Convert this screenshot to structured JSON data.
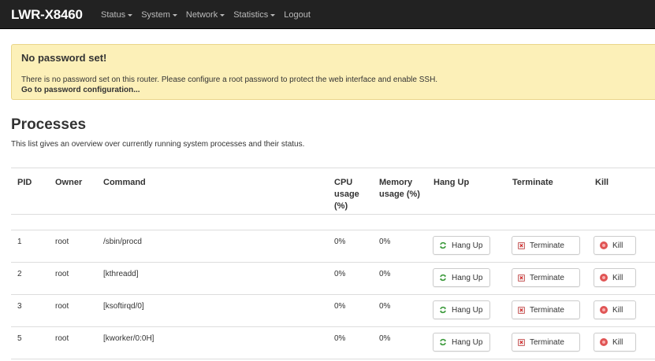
{
  "header": {
    "brand": "LWR-X8460",
    "nav": [
      {
        "label": "Status",
        "dropdown": true
      },
      {
        "label": "System",
        "dropdown": true
      },
      {
        "label": "Network",
        "dropdown": true
      },
      {
        "label": "Statistics",
        "dropdown": true
      },
      {
        "label": "Logout",
        "dropdown": false
      }
    ]
  },
  "alert": {
    "title": "No password set!",
    "text": "There is no password set on this router. Please configure a root password to protect the web interface and enable SSH.",
    "link": "Go to password configuration..."
  },
  "page": {
    "title": "Processes",
    "description": "This list gives an overview over currently running system processes and their status."
  },
  "table": {
    "headers": {
      "pid": "PID",
      "owner": "Owner",
      "command": "Command",
      "cpu": "CPU usage (%)",
      "memory": "Memory usage (%)",
      "hangup": "Hang Up",
      "terminate": "Terminate",
      "kill": "Kill"
    },
    "buttons": {
      "hangup": "Hang Up",
      "terminate": "Terminate",
      "kill": "Kill"
    },
    "rows": [
      {
        "pid": "1",
        "owner": "root",
        "command": "/sbin/procd",
        "cpu": "0%",
        "memory": "0%"
      },
      {
        "pid": "2",
        "owner": "root",
        "command": "[kthreadd]",
        "cpu": "0%",
        "memory": "0%"
      },
      {
        "pid": "3",
        "owner": "root",
        "command": "[ksoftirqd/0]",
        "cpu": "0%",
        "memory": "0%"
      },
      {
        "pid": "5",
        "owner": "root",
        "command": "[kworker/0:0H]",
        "cpu": "0%",
        "memory": "0%"
      }
    ]
  },
  "colors": {
    "navbar": "#222222",
    "alert_bg": "#fcf0b8",
    "kill_icon": "#e05555",
    "hangup_icon": "#3c9a3c"
  },
  "icons": {
    "hangup": "refresh-icon",
    "terminate": "close-box-icon",
    "kill": "stop-circle-icon"
  }
}
